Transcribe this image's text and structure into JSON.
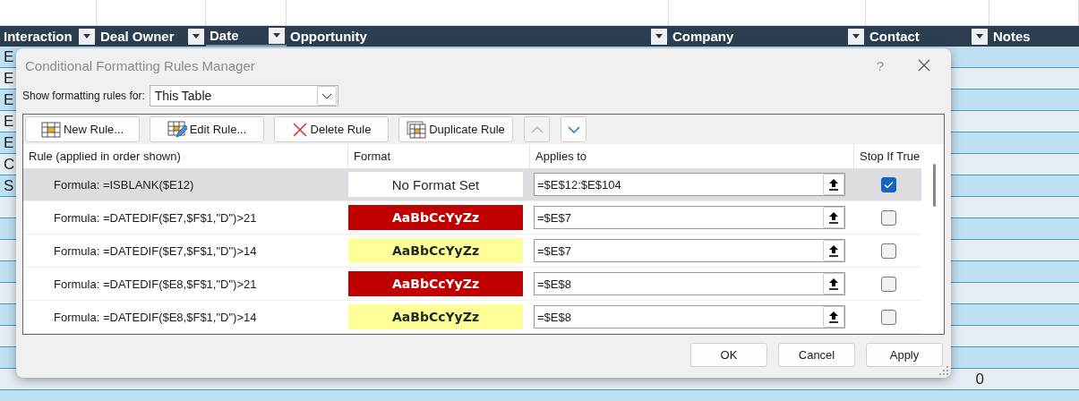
{
  "sheet": {
    "columns": [
      {
        "label": "Interaction",
        "filter": true,
        "selected": false
      },
      {
        "label": "Deal Owner",
        "filter": true,
        "selected": false
      },
      {
        "label": "Date",
        "filter": true,
        "selected": true
      },
      {
        "label": "Opportunity",
        "filter": true,
        "selected": false
      },
      {
        "label": "Company",
        "filter": true,
        "selected": false
      },
      {
        "label": "Contact",
        "filter": true,
        "selected": false
      },
      {
        "label": "Notes",
        "filter": false,
        "selected": false
      }
    ],
    "rows": [
      {
        "interaction": "E"
      },
      {
        "interaction": "E"
      },
      {
        "interaction": "E"
      },
      {
        "interaction": "E"
      },
      {
        "interaction": "E"
      },
      {
        "interaction": "C"
      },
      {
        "interaction": "S"
      },
      {},
      {},
      {},
      {},
      {},
      {},
      {},
      {},
      {
        "contact": "0"
      },
      {}
    ]
  },
  "dialog": {
    "title": "Conditional Formatting Rules Manager",
    "help": "?",
    "show_label": "Show formatting rules for:",
    "scope": "This Table",
    "toolbar": [
      {
        "kind": "new",
        "label": "New Rule..."
      },
      {
        "kind": "edit",
        "label": "Edit Rule..."
      },
      {
        "kind": "delete",
        "label": "Delete Rule"
      },
      {
        "kind": "duplicate",
        "label": "Duplicate Rule"
      },
      {
        "kind": "up",
        "disabled": true
      },
      {
        "kind": "down",
        "disabled": false
      }
    ],
    "columns": [
      "Rule (applied in order shown)",
      "Format",
      "Applies to",
      "Stop If True"
    ],
    "rules": [
      {
        "rule": "Formula: =ISBLANK($E12)",
        "format": {
          "sample": "No Format Set",
          "color": "#ffffff",
          "bold": false
        },
        "applies_to": "=$E$12:$E$104",
        "stop_if_true": true,
        "selected": true
      },
      {
        "rule": "Formula: =DATEDIF($E7,$F$1,\"D\")>21",
        "format": {
          "sample": "AaBbCcYyZz",
          "color": "#c00000",
          "bold": true
        },
        "applies_to": "=$E$7",
        "stop_if_true": false,
        "selected": false
      },
      {
        "rule": "Formula: =DATEDIF($E7,$F$1,\"D\")>14",
        "format": {
          "sample": "AaBbCcYyZz",
          "color": "#ffff99",
          "bold": true
        },
        "applies_to": "=$E$7",
        "stop_if_true": false,
        "selected": false
      },
      {
        "rule": "Formula: =DATEDIF($E8,$F$1,\"D\")>21",
        "format": {
          "sample": "AaBbCcYyZz",
          "color": "#c00000",
          "bold": true
        },
        "applies_to": "=$E$8",
        "stop_if_true": false,
        "selected": false
      },
      {
        "rule": "Formula: =DATEDIF($E8,$F$1,\"D\")>14",
        "format": {
          "sample": "AaBbCcYyZz",
          "color": "#ffff99",
          "bold": true
        },
        "applies_to": "=$E$8",
        "stop_if_true": false,
        "selected": false
      }
    ],
    "buttons": [
      "OK",
      "Cancel",
      "Apply"
    ]
  }
}
